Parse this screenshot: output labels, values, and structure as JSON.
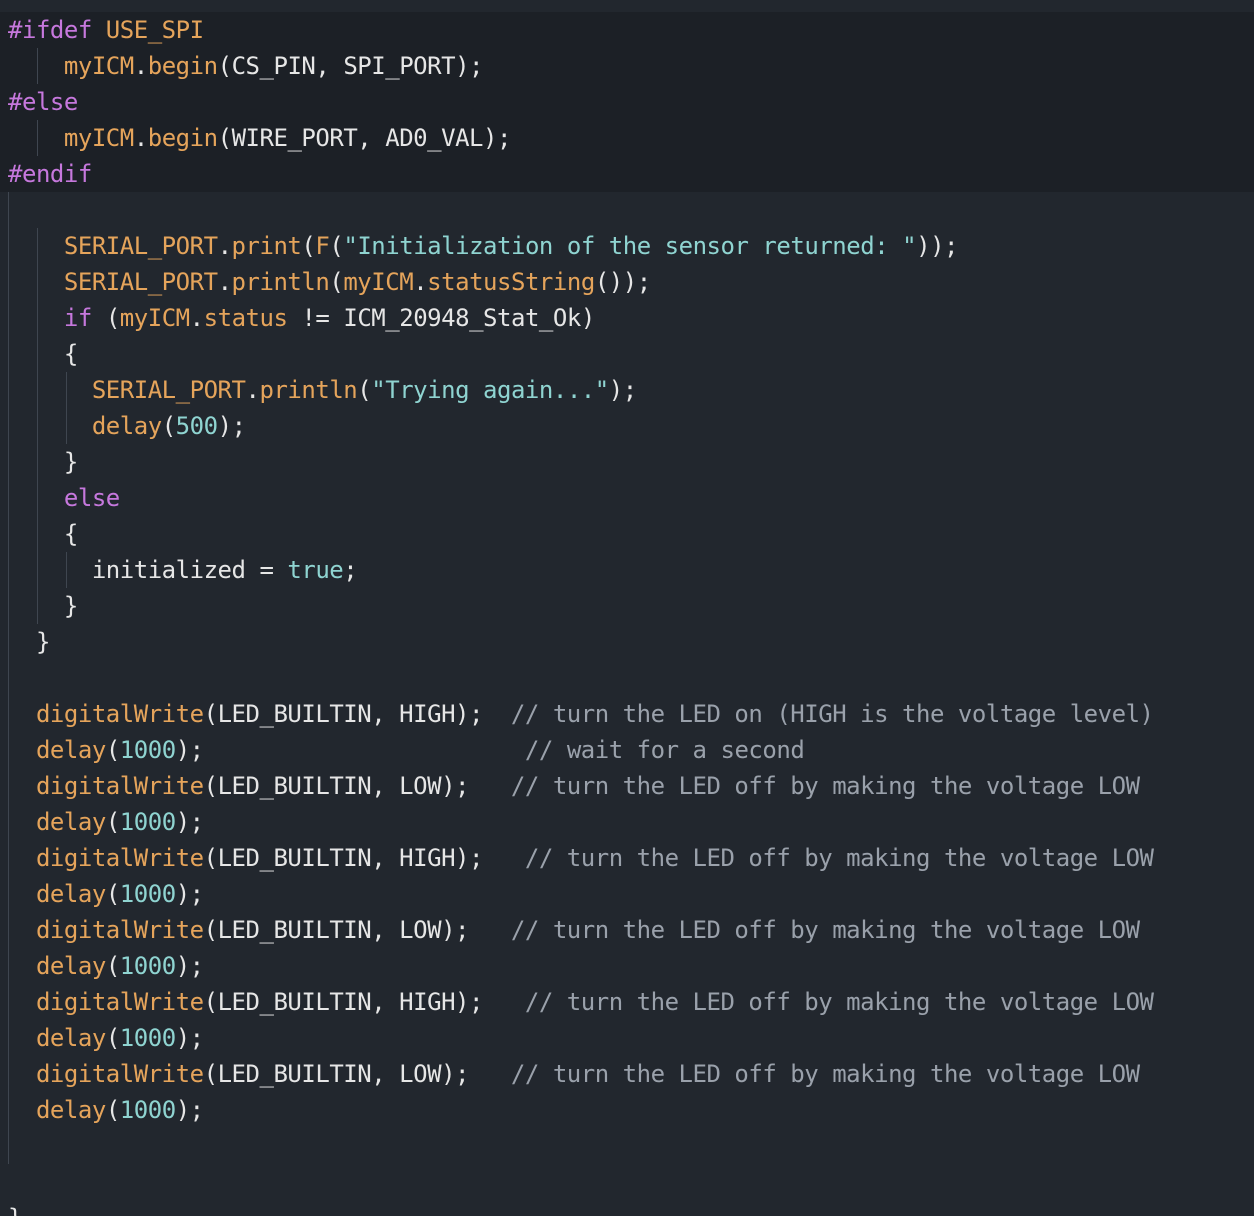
{
  "colors": {
    "background": "#22272e",
    "highlight_band": "#1c2026",
    "guide": "#3f4650",
    "preprocessor": "#c678dd",
    "keyword": "#c678dd",
    "function": "#e5a45b",
    "string": "#8fd4d1",
    "number": "#8fd4d1",
    "comment": "#9aa1ab",
    "plain": "#e6e6e6"
  },
  "lines": [
    [
      {
        "t": "#ifdef ",
        "k": "pre"
      },
      {
        "t": "USE_SPI",
        "k": "fn"
      }
    ],
    [
      {
        "t": "    ",
        "k": "pl"
      },
      {
        "t": "myICM",
        "k": "fn"
      },
      {
        "t": ".",
        "k": "pl"
      },
      {
        "t": "begin",
        "k": "fn"
      },
      {
        "t": "(CS_PIN, SPI_PORT);",
        "k": "pl"
      }
    ],
    [
      {
        "t": "#else",
        "k": "pre"
      }
    ],
    [
      {
        "t": "    ",
        "k": "pl"
      },
      {
        "t": "myICM",
        "k": "fn"
      },
      {
        "t": ".",
        "k": "pl"
      },
      {
        "t": "begin",
        "k": "fn"
      },
      {
        "t": "(WIRE_PORT, AD0_VAL);",
        "k": "pl"
      }
    ],
    [
      {
        "t": "#endif",
        "k": "pre"
      }
    ],
    [],
    [
      {
        "t": "    ",
        "k": "pl"
      },
      {
        "t": "SERIAL_PORT",
        "k": "fn"
      },
      {
        "t": ".",
        "k": "pl"
      },
      {
        "t": "print",
        "k": "fn"
      },
      {
        "t": "(",
        "k": "pl"
      },
      {
        "t": "F",
        "k": "fn"
      },
      {
        "t": "(",
        "k": "pl"
      },
      {
        "t": "\"Initialization of the sensor returned: \"",
        "k": "str"
      },
      {
        "t": "));",
        "k": "pl"
      }
    ],
    [
      {
        "t": "    ",
        "k": "pl"
      },
      {
        "t": "SERIAL_PORT",
        "k": "fn"
      },
      {
        "t": ".",
        "k": "pl"
      },
      {
        "t": "println",
        "k": "fn"
      },
      {
        "t": "(",
        "k": "pl"
      },
      {
        "t": "myICM",
        "k": "fn"
      },
      {
        "t": ".",
        "k": "pl"
      },
      {
        "t": "statusString",
        "k": "fn"
      },
      {
        "t": "());",
        "k": "pl"
      }
    ],
    [
      {
        "t": "    ",
        "k": "pl"
      },
      {
        "t": "if",
        "k": "kw"
      },
      {
        "t": " (",
        "k": "pl"
      },
      {
        "t": "myICM",
        "k": "fn"
      },
      {
        "t": ".",
        "k": "pl"
      },
      {
        "t": "status",
        "k": "fn"
      },
      {
        "t": " != ICM_20948_Stat_Ok)",
        "k": "pl"
      }
    ],
    [
      {
        "t": "    {",
        "k": "pl"
      }
    ],
    [
      {
        "t": "      ",
        "k": "pl"
      },
      {
        "t": "SERIAL_PORT",
        "k": "fn"
      },
      {
        "t": ".",
        "k": "pl"
      },
      {
        "t": "println",
        "k": "fn"
      },
      {
        "t": "(",
        "k": "pl"
      },
      {
        "t": "\"Trying again...\"",
        "k": "str"
      },
      {
        "t": ");",
        "k": "pl"
      }
    ],
    [
      {
        "t": "      ",
        "k": "pl"
      },
      {
        "t": "delay",
        "k": "fn"
      },
      {
        "t": "(",
        "k": "pl"
      },
      {
        "t": "500",
        "k": "num"
      },
      {
        "t": ");",
        "k": "pl"
      }
    ],
    [
      {
        "t": "    }",
        "k": "pl"
      }
    ],
    [
      {
        "t": "    ",
        "k": "pl"
      },
      {
        "t": "else",
        "k": "kw"
      }
    ],
    [
      {
        "t": "    {",
        "k": "pl"
      }
    ],
    [
      {
        "t": "      initialized = ",
        "k": "pl"
      },
      {
        "t": "true",
        "k": "bool"
      },
      {
        "t": ";",
        "k": "pl"
      }
    ],
    [
      {
        "t": "    }",
        "k": "pl"
      }
    ],
    [
      {
        "t": "  }",
        "k": "pl"
      }
    ],
    [],
    [
      {
        "t": "  ",
        "k": "pl"
      },
      {
        "t": "digitalWrite",
        "k": "fn"
      },
      {
        "t": "(LED_BUILTIN, HIGH);  ",
        "k": "pl"
      },
      {
        "t": "// turn the LED on (HIGH is the voltage level)",
        "k": "cm"
      }
    ],
    [
      {
        "t": "  ",
        "k": "pl"
      },
      {
        "t": "delay",
        "k": "fn"
      },
      {
        "t": "(",
        "k": "pl"
      },
      {
        "t": "1000",
        "k": "num"
      },
      {
        "t": ");                       ",
        "k": "pl"
      },
      {
        "t": "// wait for a second",
        "k": "cm"
      }
    ],
    [
      {
        "t": "  ",
        "k": "pl"
      },
      {
        "t": "digitalWrite",
        "k": "fn"
      },
      {
        "t": "(LED_BUILTIN, LOW);   ",
        "k": "pl"
      },
      {
        "t": "// turn the LED off by making the voltage LOW",
        "k": "cm"
      }
    ],
    [
      {
        "t": "  ",
        "k": "pl"
      },
      {
        "t": "delay",
        "k": "fn"
      },
      {
        "t": "(",
        "k": "pl"
      },
      {
        "t": "1000",
        "k": "num"
      },
      {
        "t": ");",
        "k": "pl"
      }
    ],
    [
      {
        "t": "  ",
        "k": "pl"
      },
      {
        "t": "digitalWrite",
        "k": "fn"
      },
      {
        "t": "(LED_BUILTIN, HIGH);   ",
        "k": "pl"
      },
      {
        "t": "// turn the LED off by making the voltage LOW",
        "k": "cm"
      }
    ],
    [
      {
        "t": "  ",
        "k": "pl"
      },
      {
        "t": "delay",
        "k": "fn"
      },
      {
        "t": "(",
        "k": "pl"
      },
      {
        "t": "1000",
        "k": "num"
      },
      {
        "t": ");",
        "k": "pl"
      }
    ],
    [
      {
        "t": "  ",
        "k": "pl"
      },
      {
        "t": "digitalWrite",
        "k": "fn"
      },
      {
        "t": "(LED_BUILTIN, LOW);   ",
        "k": "pl"
      },
      {
        "t": "// turn the LED off by making the voltage LOW",
        "k": "cm"
      }
    ],
    [
      {
        "t": "  ",
        "k": "pl"
      },
      {
        "t": "delay",
        "k": "fn"
      },
      {
        "t": "(",
        "k": "pl"
      },
      {
        "t": "1000",
        "k": "num"
      },
      {
        "t": ");",
        "k": "pl"
      }
    ],
    [
      {
        "t": "  ",
        "k": "pl"
      },
      {
        "t": "digitalWrite",
        "k": "fn"
      },
      {
        "t": "(LED_BUILTIN, HIGH);   ",
        "k": "pl"
      },
      {
        "t": "// turn the LED off by making the voltage LOW",
        "k": "cm"
      }
    ],
    [
      {
        "t": "  ",
        "k": "pl"
      },
      {
        "t": "delay",
        "k": "fn"
      },
      {
        "t": "(",
        "k": "pl"
      },
      {
        "t": "1000",
        "k": "num"
      },
      {
        "t": ");",
        "k": "pl"
      }
    ],
    [
      {
        "t": "  ",
        "k": "pl"
      },
      {
        "t": "digitalWrite",
        "k": "fn"
      },
      {
        "t": "(LED_BUILTIN, LOW);   ",
        "k": "pl"
      },
      {
        "t": "// turn the LED off by making the voltage LOW",
        "k": "cm"
      }
    ],
    [
      {
        "t": "  ",
        "k": "pl"
      },
      {
        "t": "delay",
        "k": "fn"
      },
      {
        "t": "(",
        "k": "pl"
      },
      {
        "t": "1000",
        "k": "num"
      },
      {
        "t": ");",
        "k": "pl"
      }
    ],
    [],
    [],
    [
      {
        "t": "}",
        "k": "pl"
      }
    ]
  ]
}
